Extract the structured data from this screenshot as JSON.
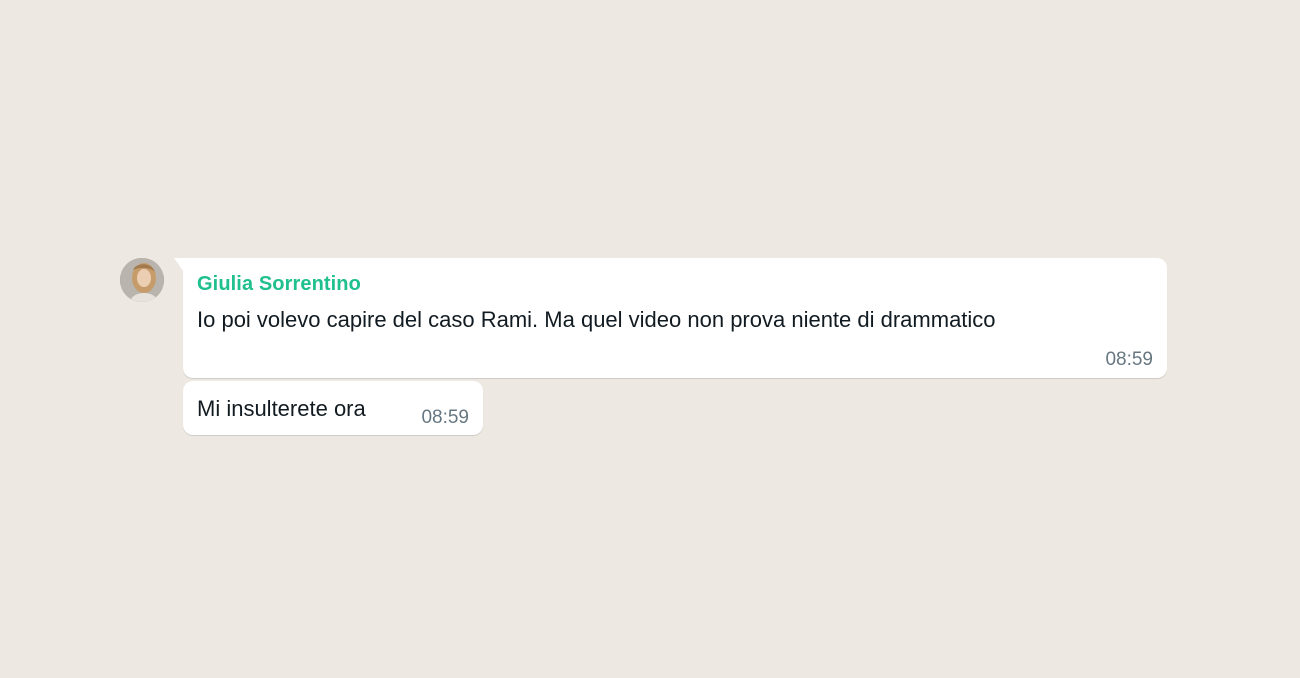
{
  "chat": {
    "messages": [
      {
        "sender": "Giulia Sorrentino",
        "text": "Io poi volevo capire del caso Rami. Ma quel video non prova niente di drammatico",
        "time": "08:59"
      },
      {
        "text": "Mi insulterete ora",
        "time": "08:59"
      }
    ]
  },
  "colors": {
    "background": "#ede8e1",
    "bubble": "#ffffff",
    "sender_name": "#1fbf8e",
    "text": "#111b21",
    "timestamp": "#667781"
  },
  "icons": {
    "avatar": "user-avatar-photo"
  }
}
